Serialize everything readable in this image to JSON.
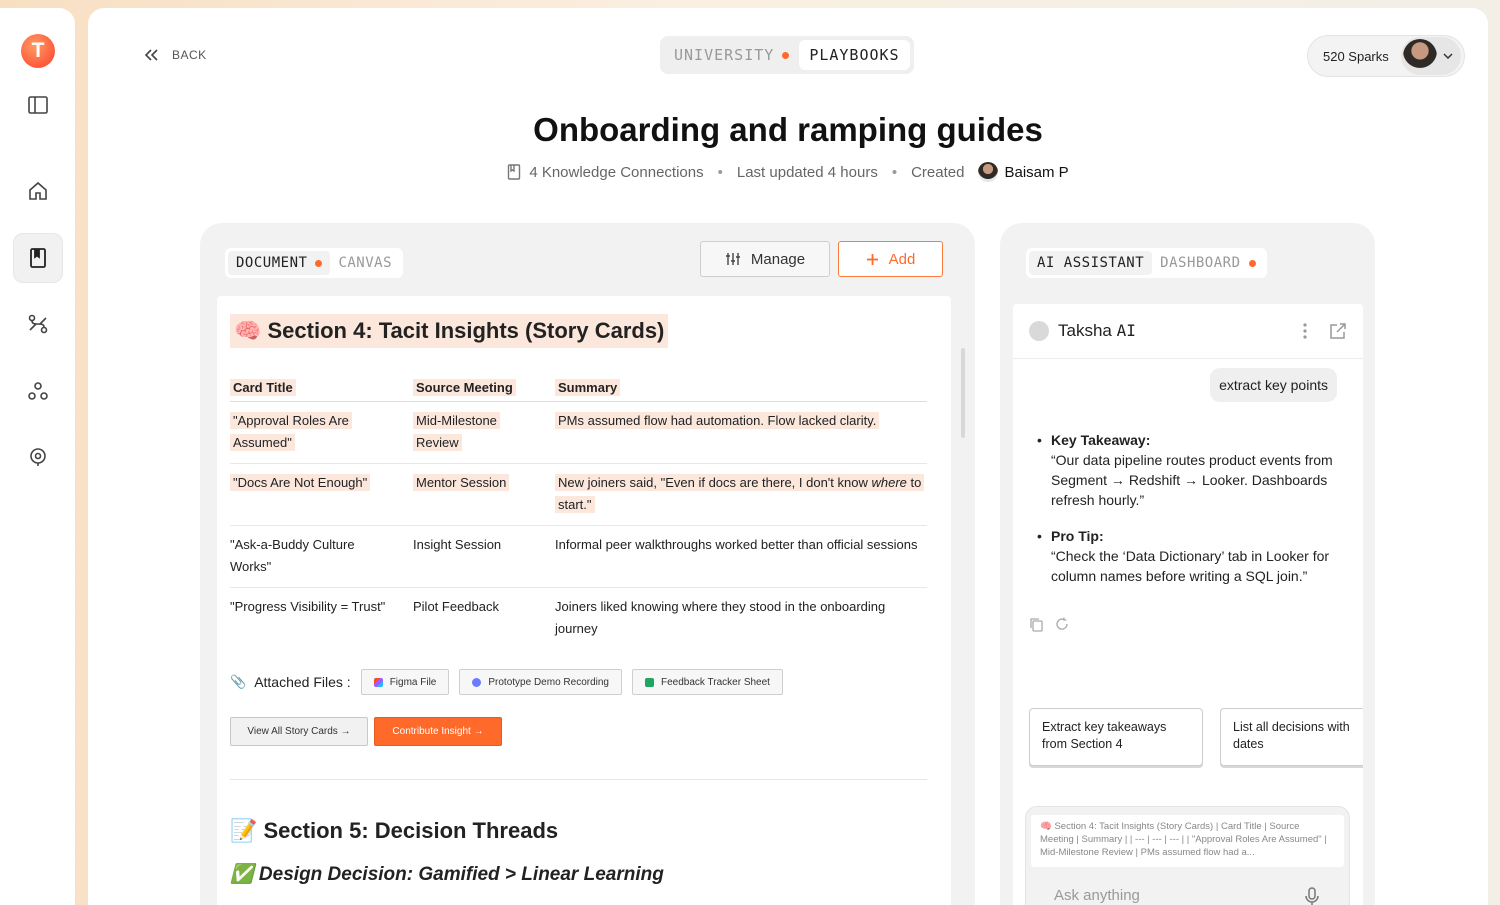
{
  "sidebar": {
    "logo_letter": "T",
    "items": [
      "panel-toggle",
      "home",
      "playbooks",
      "workflows",
      "teams",
      "support"
    ]
  },
  "header": {
    "back_label": "BACK",
    "switch": {
      "university": "UNIVERSITY",
      "playbooks": "PLAYBOOKS"
    },
    "sparks": "520 Sparks"
  },
  "page": {
    "title": "Onboarding and ramping guides",
    "knowledge": "4 Knowledge Connections",
    "updated": "Last updated 4 hours",
    "created_label": "Created",
    "creator": "Baisam P"
  },
  "doc_panel": {
    "tabs": {
      "document": "DOCUMENT",
      "canvas": "CANVAS"
    },
    "manage": "Manage",
    "add": "Add",
    "section4": "🧠 Section 4: Tacit Insights (Story Cards)",
    "columns": [
      "Card Title",
      "Source Meeting",
      "Summary"
    ],
    "rows": [
      {
        "title": "\"Approval Roles Are Assumed\"",
        "meeting": "Mid-Milestone Review",
        "summary": "PMs assumed flow had automation. Flow lacked clarity.",
        "highlight": true
      },
      {
        "title": "\"Docs Are Not Enough\"",
        "meeting": "Mentor Session",
        "summary": "New joiners said, \"Even if docs are there, I don't know where to start.\"",
        "highlight": true
      },
      {
        "title": "\"Ask-a-Buddy Culture Works\"",
        "meeting": "Insight Session",
        "summary": "Informal peer walkthroughs worked better than official sessions",
        "highlight": false
      },
      {
        "title": "\"Progress Visibility = Trust\"",
        "meeting": "Pilot Feedback",
        "summary": "Joiners liked knowing where they stood in the onboarding journey",
        "highlight": false
      }
    ],
    "summary_2_pre": "New joiners said, \"Even if docs are there, I don't know ",
    "summary_2_em": "where",
    "summary_2_post": " to start.\"",
    "attached_label": "Attached Files :",
    "files": [
      "Figma File",
      "Prototype Demo Recording",
      "Feedback Tracker Sheet"
    ],
    "view_all": "View All Story Cards →",
    "contribute": "Contribute Insight →",
    "section5": "📝 Section 5: Decision Threads",
    "decision": "✅ Design Decision: Gamified > Linear Learning"
  },
  "ai_panel": {
    "tabs": {
      "assistant": "AI ASSISTANT",
      "dashboard": "DASHBOARD"
    },
    "bot_name": "Taksha",
    "bot_suffix": "AI",
    "user_msg": "extract key points",
    "answer": [
      {
        "key": "Key Takeaway:",
        "text": "“Our data pipeline routes product events from Segment → Redshift → Looker. Dashboards refresh hourly.”"
      },
      {
        "key": "Pro Tip:",
        "text": "“Check the ‘Data Dictionary’ tab in Looker for column names before writing a SQL join.”"
      }
    ],
    "suggestions": [
      "Extract key takeaways from Section 4",
      "List all decisions with dates"
    ],
    "quoted": "🧠 Section 4: Tacit Insights (Story Cards) | Card Title | Source Meeting | Summary | | --- | --- | --- | | \"Approval Roles Are Assumed\" | Mid-Milestone Review | PMs assumed flow had a...",
    "placeholder": "Ask anything"
  }
}
